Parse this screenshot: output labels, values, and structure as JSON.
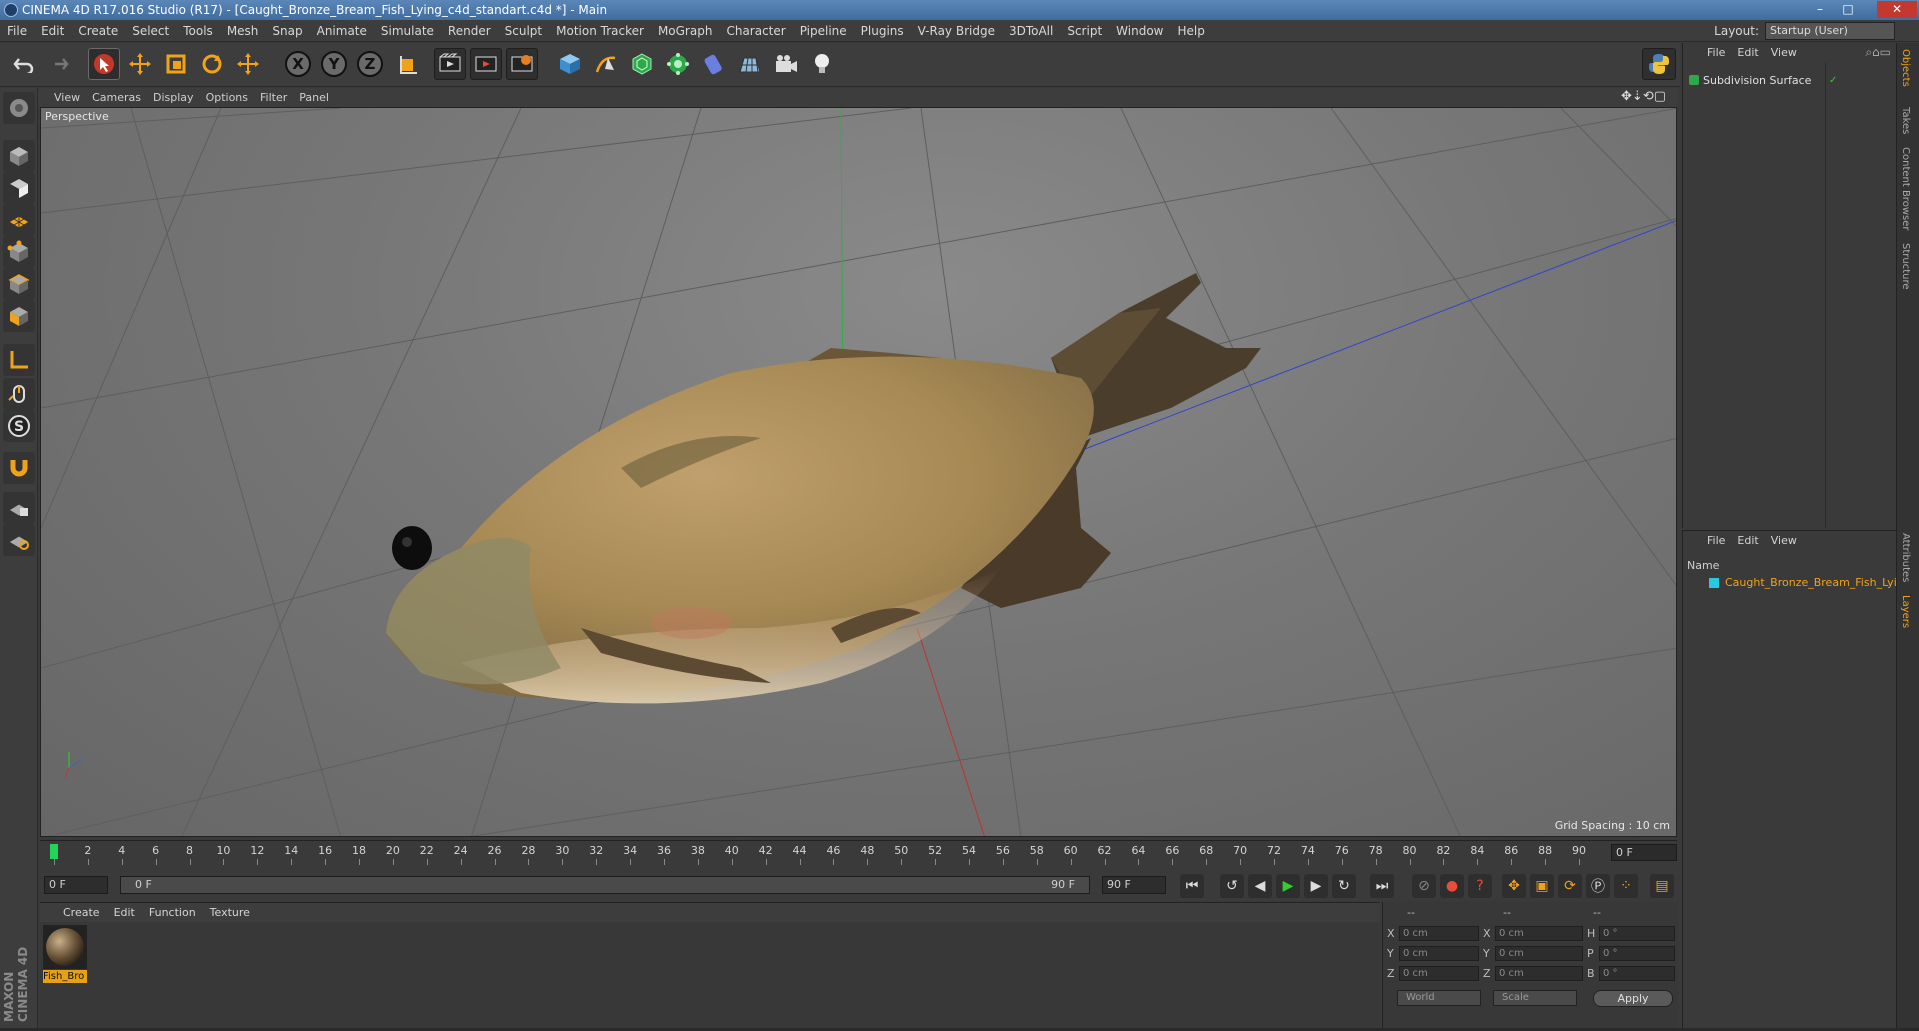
{
  "window": {
    "title": "CINEMA 4D R17.016 Studio (R17) - [Caught_Bronze_Bream_Fish_Lying_c4d_standart.c4d *] - Main",
    "minimize": "–",
    "maximize": "□",
    "close": "✕"
  },
  "menubar": {
    "items": [
      "File",
      "Edit",
      "Create",
      "Select",
      "Tools",
      "Mesh",
      "Snap",
      "Animate",
      "Simulate",
      "Render",
      "Sculpt",
      "Motion Tracker",
      "MoGraph",
      "Character",
      "Pipeline",
      "Plugins",
      "V-Ray Bridge",
      "3DToAll",
      "Script",
      "Window",
      "Help"
    ],
    "layout_label": "Layout:",
    "layout_value": "Startup (User)"
  },
  "toolbar": {
    "undo_icon": "undo-icon",
    "axis_labels": [
      "X",
      "Y",
      "Z"
    ]
  },
  "viewport": {
    "menu": [
      "View",
      "Cameras",
      "Display",
      "Options",
      "Filter",
      "Panel"
    ],
    "label": "Perspective",
    "grid_spacing": "Grid Spacing : 10 cm"
  },
  "timeline": {
    "ticks": [
      "0",
      "2",
      "4",
      "6",
      "8",
      "10",
      "12",
      "14",
      "16",
      "18",
      "20",
      "22",
      "24",
      "26",
      "28",
      "30",
      "32",
      "34",
      "36",
      "38",
      "40",
      "42",
      "44",
      "46",
      "48",
      "50",
      "52",
      "54",
      "56",
      "58",
      "60",
      "62",
      "64",
      "66",
      "68",
      "70",
      "72",
      "74",
      "76",
      "78",
      "80",
      "82",
      "84",
      "86",
      "88",
      "90"
    ],
    "current_frame": "0 F",
    "start_field": "0 F",
    "range_start": "0 F",
    "range_end": "90 F",
    "end_field": "90 F"
  },
  "material_manager": {
    "menu": [
      "Create",
      "Edit",
      "Function",
      "Texture"
    ],
    "material_name": "Fish_Bro"
  },
  "coordinates": {
    "header_dashes": [
      "--",
      "--",
      "--"
    ],
    "rows": [
      {
        "a": "X",
        "av": "0 cm",
        "b": "X",
        "bv": "0 cm",
        "c": "H",
        "cv": "0 °"
      },
      {
        "a": "Y",
        "av": "0 cm",
        "b": "Y",
        "bv": "0 cm",
        "c": "P",
        "cv": "0 °"
      },
      {
        "a": "Z",
        "av": "0 cm",
        "b": "Z",
        "bv": "0 cm",
        "c": "B",
        "cv": "0 °"
      }
    ],
    "space": "World",
    "mode": "Scale",
    "apply": "Apply"
  },
  "object_manager": {
    "menu": [
      "File",
      "Edit",
      "View"
    ],
    "object": "Subdivision Surface"
  },
  "layer_manager": {
    "menu": [
      "File",
      "Edit",
      "View"
    ],
    "column_name": "Name",
    "layer": "Caught_Bronze_Bream_Fish_Lying"
  },
  "side_tabs": [
    "Objects",
    "Takes",
    "Content Browser",
    "Structure",
    "Attributes",
    "Layers"
  ],
  "branding": "MAXON CINEMA 4D"
}
